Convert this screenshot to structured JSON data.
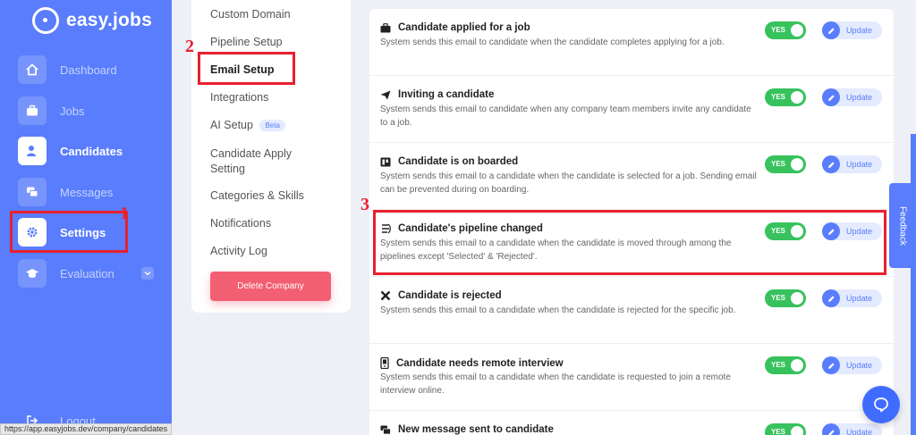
{
  "app": {
    "name": "easy.jobs"
  },
  "sidebar": {
    "items": [
      {
        "label": "Dashboard",
        "icon": "home-icon"
      },
      {
        "label": "Jobs",
        "icon": "briefcase-icon"
      },
      {
        "label": "Candidates",
        "icon": "user-icon"
      },
      {
        "label": "Messages",
        "icon": "messages-icon"
      },
      {
        "label": "Settings",
        "icon": "gear-icon"
      },
      {
        "label": "Evaluation",
        "icon": "graduation-cap-icon"
      }
    ],
    "logout": "Logout"
  },
  "status_url": "https://app.easyjobs.dev/company/candidates",
  "settings_menu": {
    "items": [
      "Custom Domain",
      "Pipeline Setup",
      "Email Setup",
      "Integrations",
      "AI Setup",
      "Candidate Apply Setting",
      "Categories & Skills",
      "Notifications",
      "Activity Log"
    ],
    "beta_badge": "Beta",
    "delete_button": "Delete Company"
  },
  "emails": [
    {
      "title": "Candidate applied for a job",
      "description": "System sends this email to candidate when the candidate completes applying for a job.",
      "toggle": "YES",
      "update": "Update",
      "icon": "briefcase-icon"
    },
    {
      "title": "Inviting a candidate",
      "description": "System sends this email to candidate when any company team members invite any candidate to a job.",
      "toggle": "YES",
      "update": "Update",
      "icon": "paper-plane-icon"
    },
    {
      "title": "Candidate is on boarded",
      "description": "System sends this email to a candidate when the candidate is selected for a job. Sending email can be prevented during on boarding.",
      "toggle": "YES",
      "update": "Update",
      "icon": "board-icon"
    },
    {
      "title": "Candidate's pipeline changed",
      "description": "System sends this email to a candidate when the candidate is moved through among the pipelines except 'Selected' & 'Rejected'.",
      "toggle": "YES",
      "update": "Update",
      "icon": "pipeline-icon"
    },
    {
      "title": "Candidate is rejected",
      "description": "System sends this email to a candidate when the candidate is rejected for the specific job.",
      "toggle": "YES",
      "update": "Update",
      "icon": "close-icon"
    },
    {
      "title": "Candidate needs remote interview",
      "description": "System sends this email to a candidate when the candidate is requested to join a remote interview online.",
      "toggle": "YES",
      "update": "Update",
      "icon": "phone-icon"
    },
    {
      "title": "New message sent to candidate",
      "description": "",
      "toggle": "YES",
      "update": "Update",
      "icon": "messages-icon"
    }
  ],
  "annotations": [
    "1",
    "2",
    "3"
  ],
  "feedback": "Feedback",
  "colors": {
    "sidebar": "#597dfc",
    "accent": "#597dfc",
    "toggle_on": "#37c25d",
    "highlight": "#e8202e",
    "delete": "#f35f72"
  }
}
